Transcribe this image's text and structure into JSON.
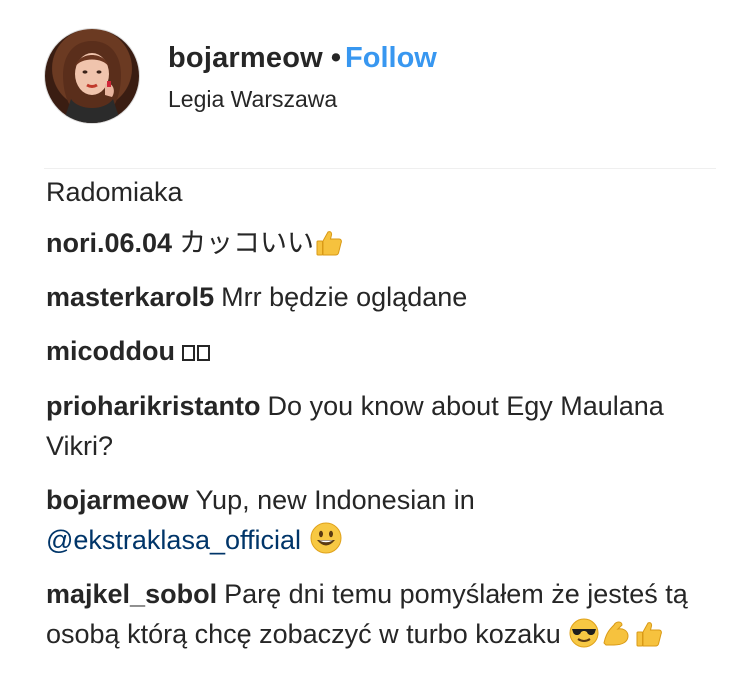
{
  "post_header": {
    "username": "bojarmeow",
    "separator": "•",
    "follow_label": "Follow",
    "location": "Legia Warszawa"
  },
  "comments": [
    {
      "username": "",
      "text": "Radomiaka"
    },
    {
      "username": "nori.06.04",
      "text": "カッコいい",
      "emoji": "thumbs-up-icon"
    },
    {
      "username": "masterkarol5",
      "text": "Mrr będzie oglądane"
    },
    {
      "username": "micoddou",
      "text": ""
    },
    {
      "username": "prioharikristanto",
      "text": "Do you know about Egy Maulana Vikri?"
    },
    {
      "username": "bojarmeow",
      "text": "Yup, new Indonesian in",
      "mention": "@ekstraklasa_official",
      "emoji": "smiley-icon"
    },
    {
      "username": "majkel_sobol",
      "text": "Parę dni temu pomyślałem że jesteś tą osobą którą chcę zobaczyć w turbo kozaku",
      "emoji": [
        "sunglasses-icon",
        "flexed-biceps-icon",
        "thumbs-up-icon"
      ]
    }
  ],
  "colors": {
    "text": "#262626",
    "follow": "#3897f0",
    "mention": "#003569",
    "divider": "#efefef"
  }
}
